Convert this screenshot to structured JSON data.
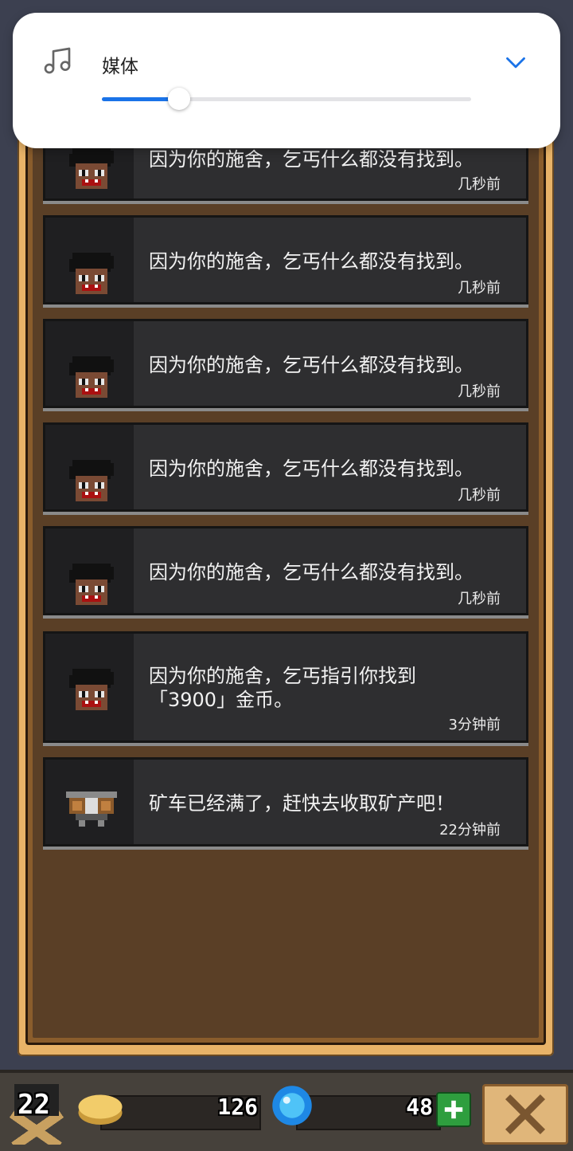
{
  "media_panel": {
    "label": "媒体",
    "icon": "music-note-icon",
    "expand_icon": "chevron-down-icon",
    "volume_level": 0.21,
    "accent_color": "#1a73e8"
  },
  "messages": [
    {
      "text": "因为你的施舍，乞丐什么都没有找到。",
      "time": "几秒前",
      "avatar": "beggar-icon"
    },
    {
      "text": "因为你的施舍，乞丐什么都没有找到。",
      "time": "几秒前",
      "avatar": "beggar-icon"
    },
    {
      "text": "因为你的施舍，乞丐什么都没有找到。",
      "time": "几秒前",
      "avatar": "beggar-icon"
    },
    {
      "text": "因为你的施舍，乞丐什么都没有找到。",
      "time": "几秒前",
      "avatar": "beggar-icon"
    },
    {
      "text": "因为你的施舍，乞丐什么都没有找到。",
      "time": "几秒前",
      "avatar": "beggar-icon"
    },
    {
      "text_line1": "因为你的施舍，乞丐指引你找到",
      "text_line2": "「3900」金币。",
      "time": "3分钟前",
      "avatar": "beggar-icon"
    },
    {
      "text": "矿车已经满了，赶快去收取矿产吧！",
      "time": "22分钟前",
      "avatar": "minecart-icon"
    }
  ],
  "bottom_bar": {
    "level": "22",
    "coins": "126",
    "gems": "48",
    "coin_icon": "coin-icon",
    "gem_icon": "gem-icon",
    "add_icon": "plus-icon",
    "close_icon": "close-icon"
  }
}
